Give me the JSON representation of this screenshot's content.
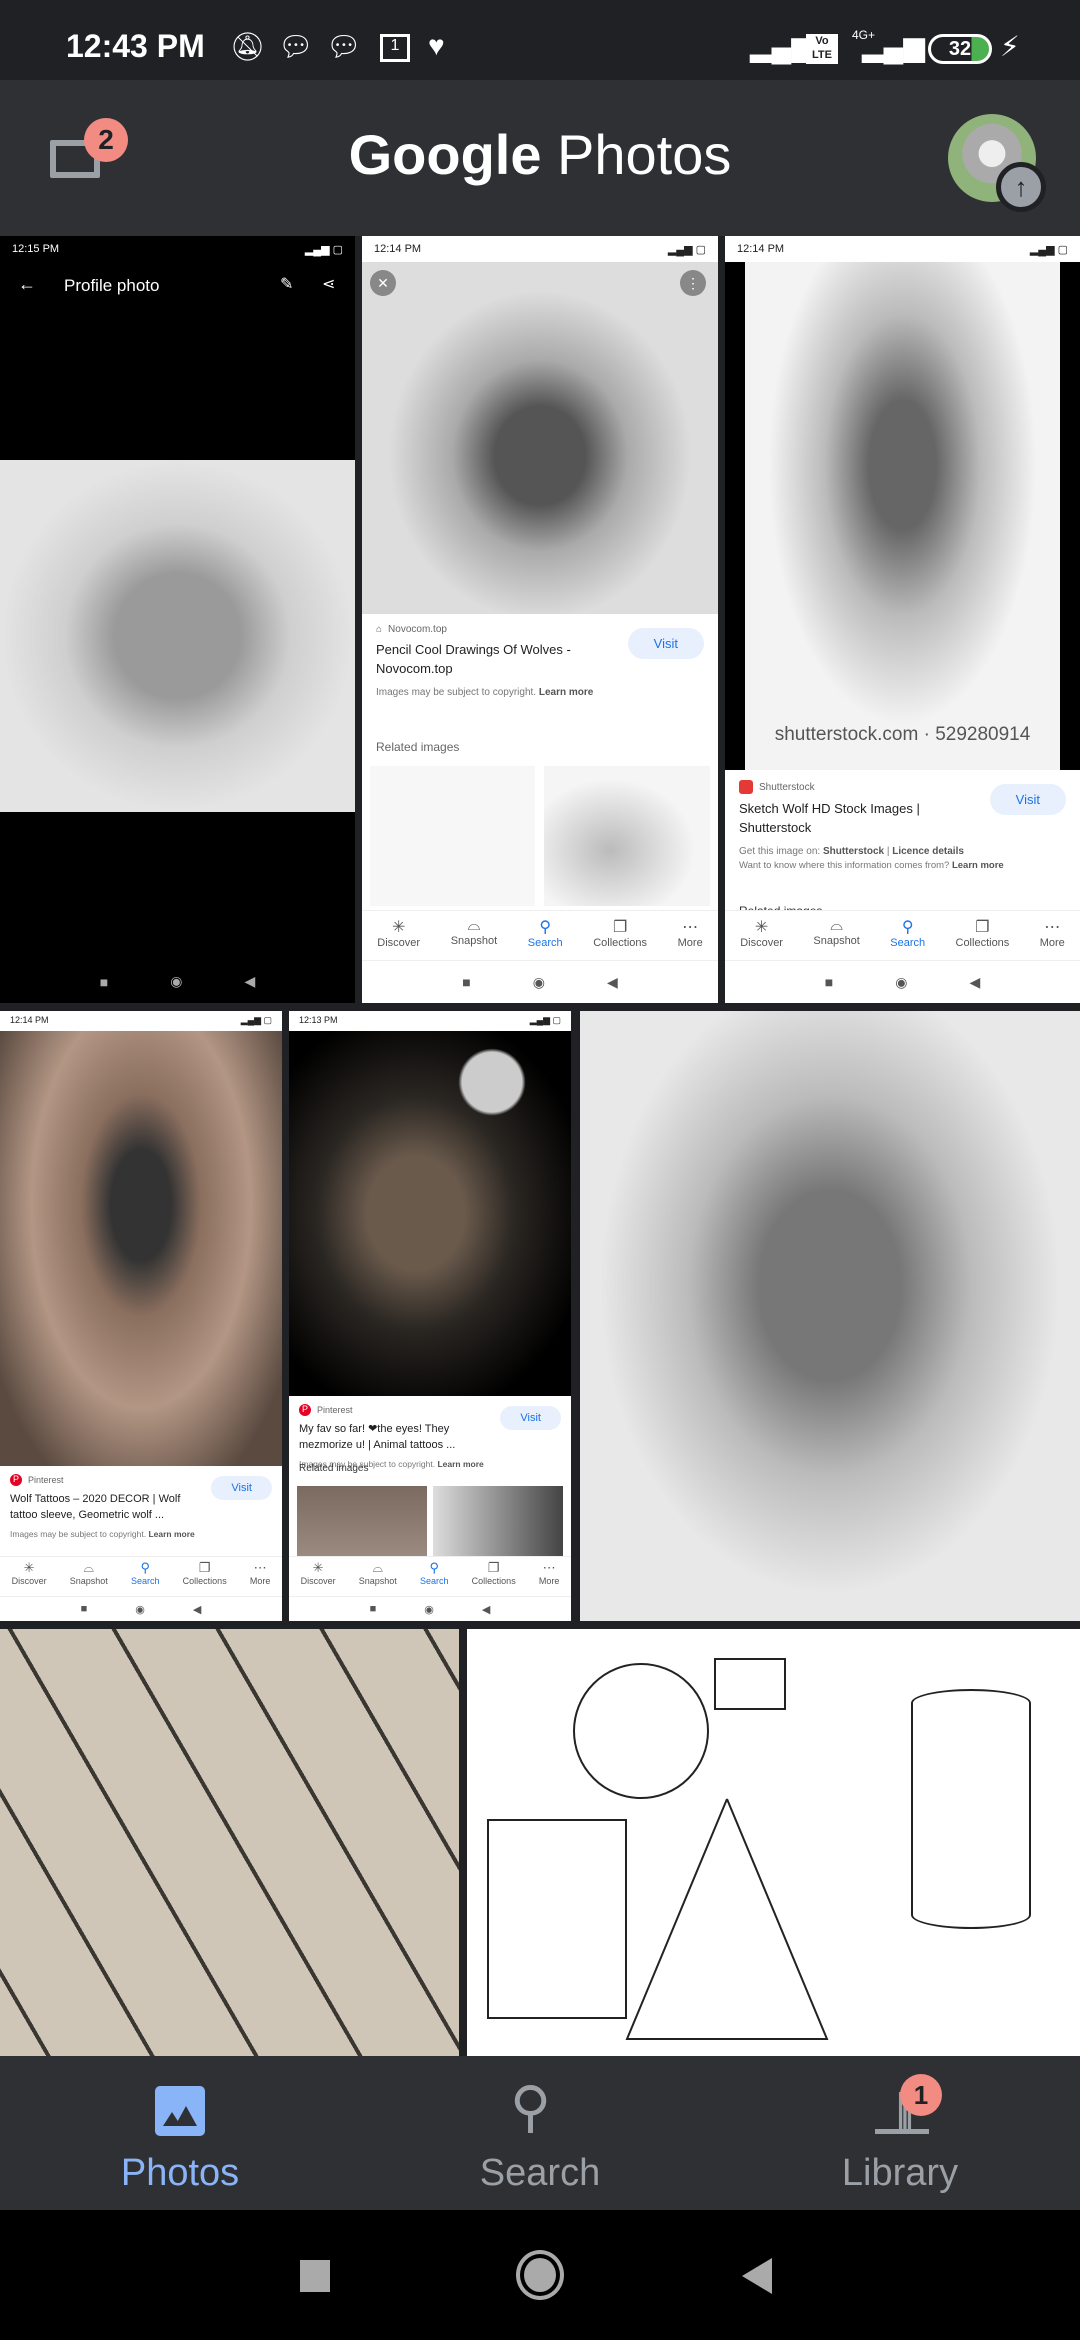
{
  "status_bar": {
    "time": "12:43 PM",
    "network": "4G+",
    "volte": "Vo LTE",
    "battery": "32",
    "icons": [
      "mute-bell-icon",
      "message-icon",
      "message-icon",
      "calendar-icon",
      "heart-check-icon"
    ]
  },
  "header": {
    "title_bold": "Google",
    "title_rest": " Photos",
    "notifications_badge": "2"
  },
  "thumbnails": [
    {
      "time": "12:15 PM",
      "toolbar_title": "Profile photo"
    },
    {
      "time": "12:14 PM",
      "source": "Novocom.top",
      "title": "Pencil Cool Drawings Of Wolves - Novocom.top",
      "note": "Images may be subject to copyright.",
      "learn_more": "Learn more",
      "visit": "Visit",
      "related": "Related images"
    },
    {
      "time": "12:14 PM",
      "watermark": "shutterstock.com · 529280914",
      "source": "Shutterstock",
      "title": "Sketch Wolf HD Stock Images | Shutterstock",
      "note_prefix": "Get this image on:",
      "note_src": "Shutterstock",
      "note_sep": " | ",
      "note_licence": "Licence details",
      "note2": "Want to know where this information comes from?",
      "learn_more": "Learn more",
      "visit": "Visit",
      "related": "Related images"
    },
    {
      "time": "12:14 PM",
      "source": "Pinterest",
      "title": "Wolf Tattoos – 2020 DECOR | Wolf tattoo sleeve, Geometric wolf ...",
      "note": "Images may be subject to copyright.",
      "learn_more": "Learn more",
      "visit": "Visit"
    },
    {
      "time": "12:13 PM",
      "source": "Pinterest",
      "title": "My fav so far! ❤the eyes! They mezmorize u! | Animal tattoos ...",
      "note": "Images may be subject to copyright.",
      "learn_more": "Learn more",
      "visit": "Visit",
      "related": "Related images"
    }
  ],
  "lens_tabs": [
    "Discover",
    "Snapshot",
    "Search",
    "Collections",
    "More"
  ],
  "bottom_nav": {
    "items": [
      {
        "label": "Photos",
        "active": true
      },
      {
        "label": "Search"
      },
      {
        "label": "Library",
        "badge": "1"
      }
    ]
  },
  "colors": {
    "accent": "#8ab4f8",
    "badge": "#f28b82",
    "header_bg": "#2f3033"
  }
}
